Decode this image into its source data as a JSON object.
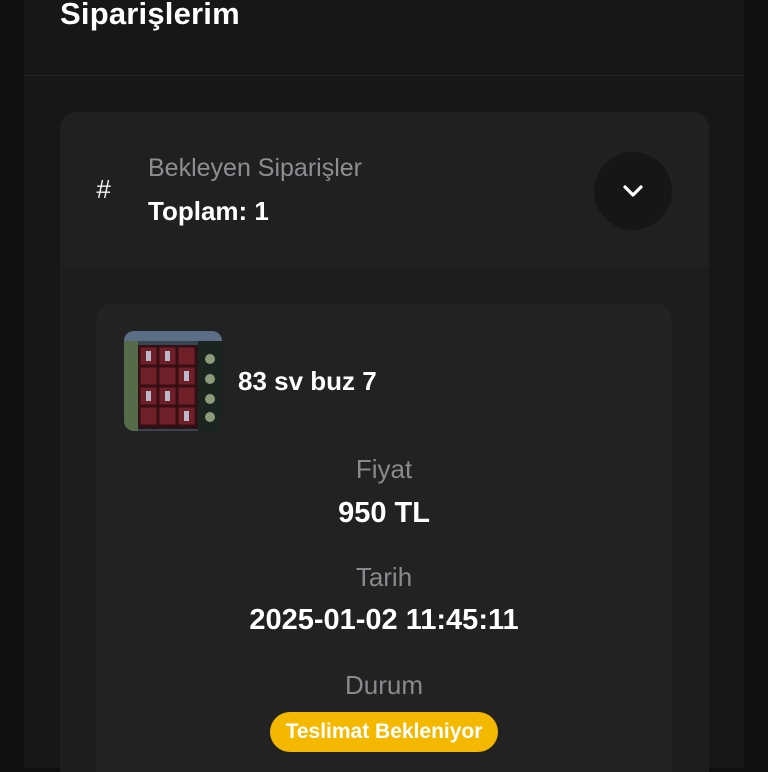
{
  "page": {
    "title": "Siparişlerim"
  },
  "accordion": {
    "icon": "hash-icon",
    "subtitle": "Bekleyen Siparişler",
    "total": "Toplam: 1",
    "toggle_icon": "chevron-down-icon"
  },
  "order": {
    "thumbnail": "game-inventory-thumbnail",
    "name": "83 sv buz 7",
    "price_label": "Fiyat",
    "price": "950 TL",
    "date_label": "Tarih",
    "date": "2025-01-02 11:45:11",
    "status_label": "Durum",
    "status": "Teslimat Bekleniyor"
  },
  "colors": {
    "background": "#0f0f10",
    "panel": "#171718",
    "card": "#222223",
    "status_badge": "#f5b800"
  }
}
